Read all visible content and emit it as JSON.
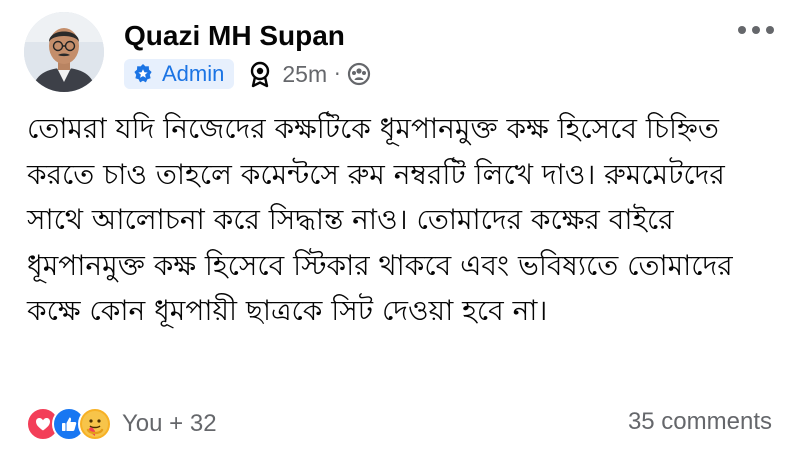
{
  "post": {
    "author": {
      "name": "Quazi MH Supan",
      "role_badge": "Admin",
      "avatar_icon": "profile-photo"
    },
    "timestamp": "25m",
    "privacy_icon": "group-privacy-icon",
    "text": "তোমরা যদি নিজেদের কক্ষটিকে ধূমপানমুক্ত কক্ষ হিসেবে চিহ্নিত করতে চাও তাহলে কমেন্টসে রুম নম্বরটি লিখে দাও। রুমমেটদের সাথে আলোচনা করে সিদ্ধান্ত নাও। তোমাদের কক্ষের বাইরে ধূমপানমুক্ত কক্ষ হিসেবে স্টিকার থাকবে এবং ভবিষ্যতে তোমাদের কক্ষে কোন ধূমপায়ী ছাত্রকে সিট দেওয়া হবে না।",
    "reactions": {
      "icons": [
        "love",
        "like",
        "care"
      ],
      "label": "You + 32"
    },
    "comments_label": "35 comments"
  },
  "colors": {
    "accent": "#1b74e4",
    "badge_bg": "#e7f0fd",
    "secondary_text": "#65676b",
    "love": "#f33e58",
    "like": "#1877f2",
    "care": "#f7b125"
  }
}
